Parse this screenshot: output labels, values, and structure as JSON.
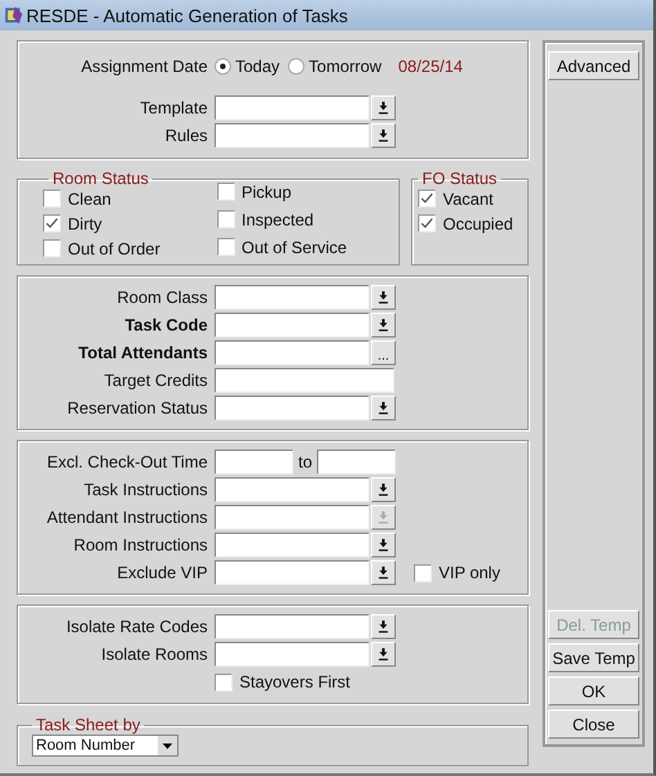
{
  "window": {
    "title": "RESDE - Automatic Generation of Tasks"
  },
  "assignment": {
    "label": "Assignment Date",
    "options": [
      {
        "label": "Today",
        "selected": true
      },
      {
        "label": "Tomorrow",
        "selected": false
      }
    ],
    "date": "08/25/14"
  },
  "template_fields": [
    {
      "label": "Template",
      "kind": "dropdown",
      "required": false,
      "disabled": false
    },
    {
      "label": "Rules",
      "kind": "dropdown",
      "required": false,
      "disabled": false
    }
  ],
  "room_status": {
    "title": "Room Status",
    "columns": [
      [
        {
          "label": "Clean",
          "checked": false
        },
        {
          "label": "Dirty",
          "checked": true
        },
        {
          "label": "Out of Order",
          "checked": false
        }
      ],
      [
        {
          "label": "Pickup",
          "checked": false
        },
        {
          "label": "Inspected",
          "checked": false
        },
        {
          "label": "Out of Service",
          "checked": false
        }
      ]
    ]
  },
  "fo_status": {
    "title": "FO Status",
    "items": [
      {
        "label": "Vacant",
        "checked": true
      },
      {
        "label": "Occupied",
        "checked": true
      }
    ]
  },
  "sections": [
    {
      "fields": [
        {
          "label": "Room Class",
          "kind": "dropdown",
          "required": false,
          "disabled": false
        },
        {
          "label": "Task Code",
          "kind": "dropdown",
          "required": true,
          "disabled": false
        },
        {
          "label": "Total Attendants",
          "kind": "lookup",
          "button_text": "...",
          "required": true,
          "disabled": false
        },
        {
          "label": "Target Credits",
          "kind": "text",
          "required": false,
          "disabled": false
        },
        {
          "label": "Reservation Status",
          "kind": "dropdown",
          "required": false,
          "disabled": false
        }
      ]
    },
    {
      "fields": [
        {
          "label": "Excl. Check-Out Time",
          "kind": "range",
          "separator": "to",
          "required": false,
          "disabled": false
        },
        {
          "label": "Task Instructions",
          "kind": "dropdown",
          "required": false,
          "disabled": false
        },
        {
          "label": "Attendant Instructions",
          "kind": "dropdown",
          "required": false,
          "disabled": true
        },
        {
          "label": "Room Instructions",
          "kind": "dropdown",
          "required": false,
          "disabled": false
        },
        {
          "label": "Exclude VIP",
          "kind": "dropdown",
          "required": false,
          "disabled": false,
          "option": {
            "label": "VIP only",
            "checked": false
          }
        }
      ]
    },
    {
      "fields": [
        {
          "label": "Isolate Rate Codes",
          "kind": "dropdown",
          "required": false,
          "disabled": false
        },
        {
          "label": "Isolate Rooms",
          "kind": "dropdown",
          "required": false,
          "disabled": false
        },
        {
          "label": "Stayovers First",
          "kind": "checkbox",
          "checked": false
        }
      ]
    }
  ],
  "task_sheet": {
    "title": "Task Sheet by",
    "value": "Room Number"
  },
  "side_buttons": {
    "top": [
      {
        "label": "Advanced",
        "disabled": false
      }
    ],
    "bottom": [
      {
        "label": "Del. Temp",
        "disabled": true
      },
      {
        "label": "Save Temp",
        "disabled": false
      },
      {
        "label": "OK",
        "disabled": false
      },
      {
        "label": "Close",
        "disabled": false
      }
    ]
  }
}
